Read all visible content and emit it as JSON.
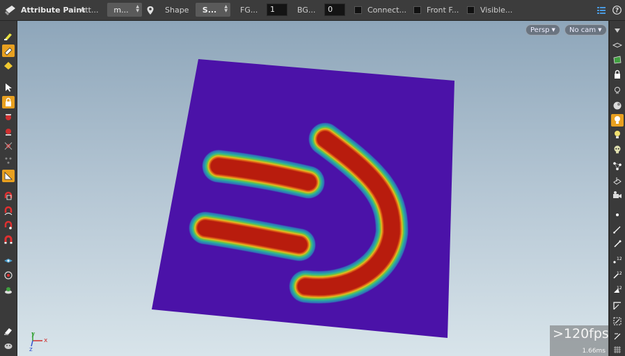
{
  "toolbar": {
    "title": "Attribute Paint",
    "attr_label": "Att...",
    "attr_value": "m...",
    "shape_label": "Shape",
    "shape_value": "S...",
    "fg_label": "FG...",
    "fg_value": "1",
    "bg_label": "BG...",
    "bg_value": "0",
    "connect_label": "Connect...",
    "connect_checked": false,
    "front_label": "Front F...",
    "front_checked": false,
    "visible_label": "Visible...",
    "visible_checked": false
  },
  "viewport": {
    "camera_view": "Persp",
    "camera": "No cam",
    "fps": ">120fps",
    "frame_time": "1.66ms",
    "axis_x": "x",
    "axis_y": "y",
    "axis_z": "z",
    "plane_color": "#4b12a8",
    "paint_color": "#b81a0a"
  },
  "left_tools": [
    "paint-brush-icon",
    "brush-active-icon",
    "eraser-icon",
    "select-arrow-icon",
    "lock-active-icon",
    "handle-red-icon",
    "handle-red-2-icon",
    "handle-x-icon",
    "dots-icon",
    "ruler-active-icon",
    "magnet-grid-icon",
    "magnet-curve-icon",
    "magnet-point-icon",
    "magnet-icon",
    "view-icon",
    "render-camera-icon",
    "flipbook-icon",
    "snapshot-icon",
    "display-icon"
  ],
  "right_tools": [
    "options-icon",
    "wire-ghost-icon",
    "shaded-icon",
    "lock-view-icon",
    "lights-icon",
    "sphere-icon",
    "light-bulb-active-icon",
    "headlight-icon",
    "skull-icon",
    "points-icon",
    "normals-icon",
    "camera-icon",
    "dot-icon",
    "pencil-icon",
    "edge-icon",
    "number-points-icon",
    "numbers-icon",
    "number-prims-icon",
    "corner-icon",
    "bounds-icon",
    "pivot-icon",
    "grid-icon"
  ]
}
